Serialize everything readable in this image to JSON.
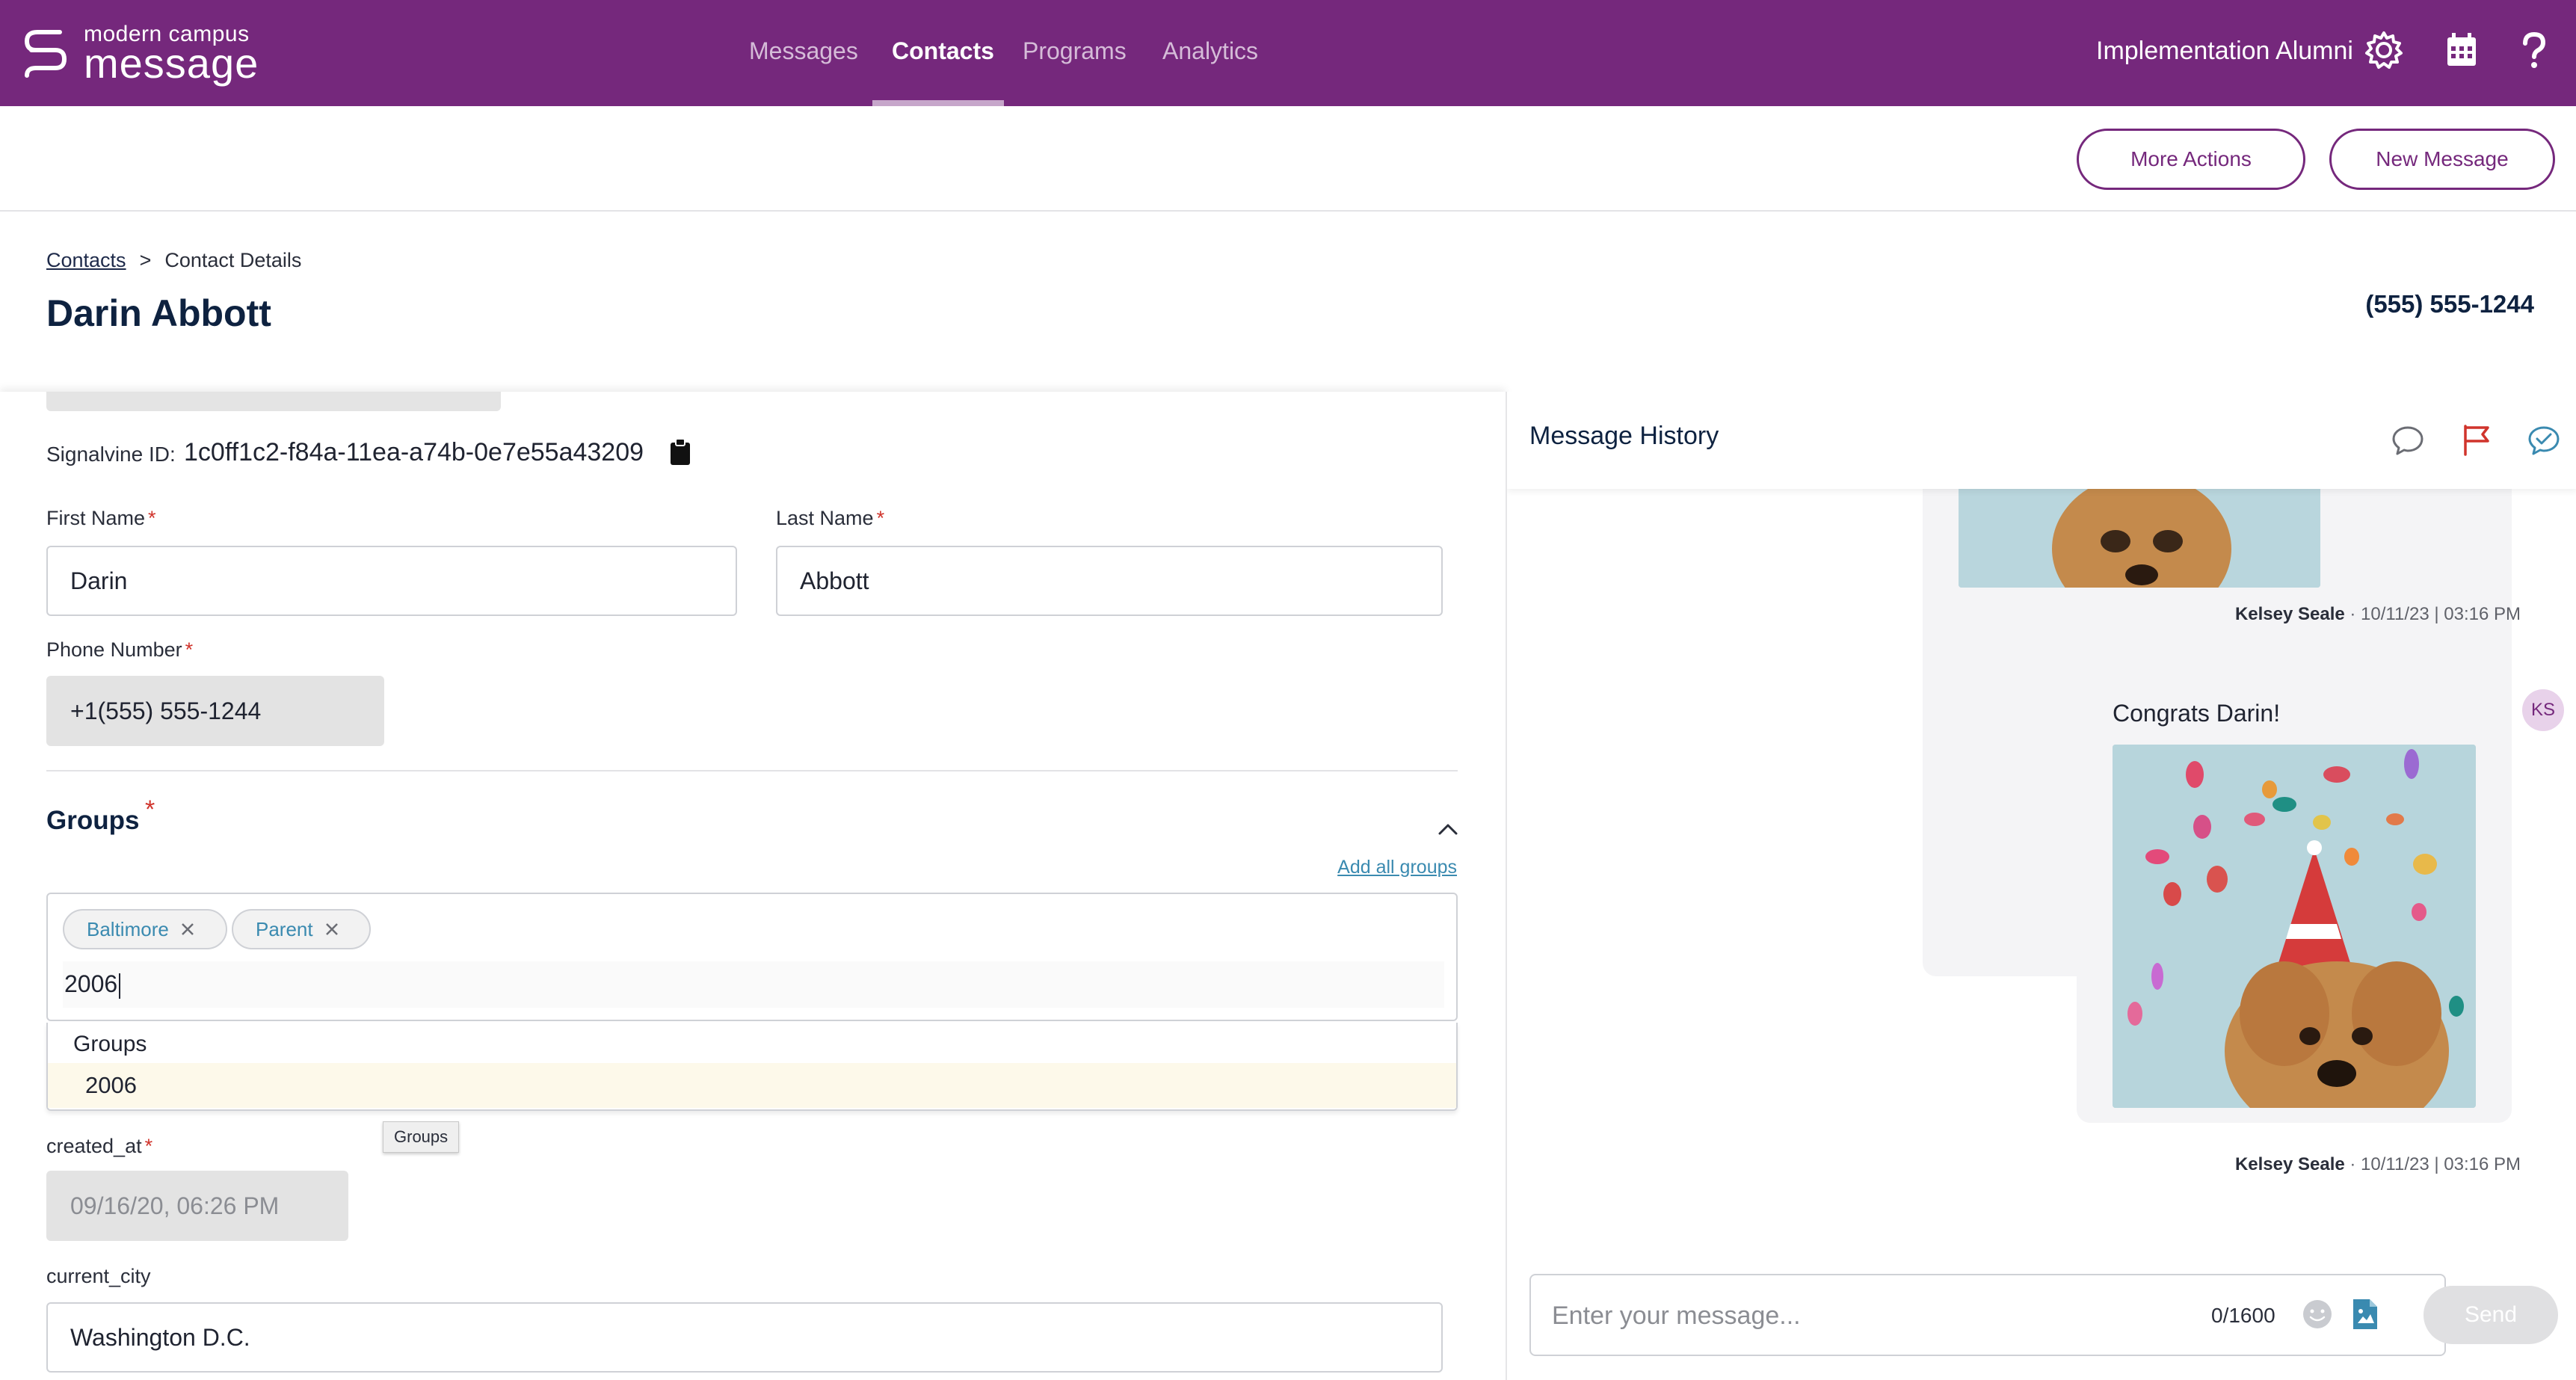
{
  "colors": {
    "brand": "#75287c",
    "required": "#d0342c",
    "link": "#3a8ab0",
    "heading": "#0e2240"
  },
  "app": {
    "logo_small": "modern campus",
    "logo_big": "message"
  },
  "nav": [
    {
      "label": "Messages",
      "active": false
    },
    {
      "label": "Contacts",
      "active": true
    },
    {
      "label": "Programs",
      "active": false
    },
    {
      "label": "Analytics",
      "active": false
    }
  ],
  "org_name": "Implementation Alumni",
  "icons": {
    "settings": "gear-icon",
    "calendar": "calendar-icon",
    "help": "help-icon"
  },
  "actions": {
    "more": "More Actions",
    "new_message": "New Message"
  },
  "breadcrumb": {
    "root": "Contacts",
    "separator": ">",
    "current": "Contact Details"
  },
  "contact": {
    "name": "Darin Abbott",
    "phone_display": "(555) 555-1244"
  },
  "form": {
    "signalvine_label": "Signalvine ID:",
    "signalvine_id": "1c0ff1c2-f84a-11ea-a74b-0e7e55a43209",
    "first_name_label": "First Name",
    "first_name": "Darin",
    "last_name_label": "Last Name",
    "last_name": "Abbott",
    "phone_label": "Phone Number",
    "phone": "+1(555) 555-1244",
    "required_mark": "*",
    "groups": {
      "title": "Groups",
      "add_all": "Add all groups",
      "chips": [
        "Baltimore",
        "Parent"
      ],
      "query": "2006",
      "dropdown_header": "Groups",
      "dropdown_options": [
        "2006"
      ],
      "tooltip": "Groups"
    },
    "created_at_label": "created_at",
    "created_at": "09/16/20, 06:26 PM",
    "current_city_label": "current_city",
    "current_city": "Washington D.C."
  },
  "message_history": {
    "title": "Message History",
    "messages": [
      {
        "author": "Kelsey Seale",
        "meta": "· 10/11/23 | 03:16 PM"
      },
      {
        "text": "Congrats Darin!",
        "author": "Kelsey Seale",
        "meta": "· 10/11/23 | 03:16 PM",
        "avatar": "KS"
      }
    ],
    "composer": {
      "placeholder": "Enter your message...",
      "count": "0/1600",
      "send": "Send"
    }
  }
}
